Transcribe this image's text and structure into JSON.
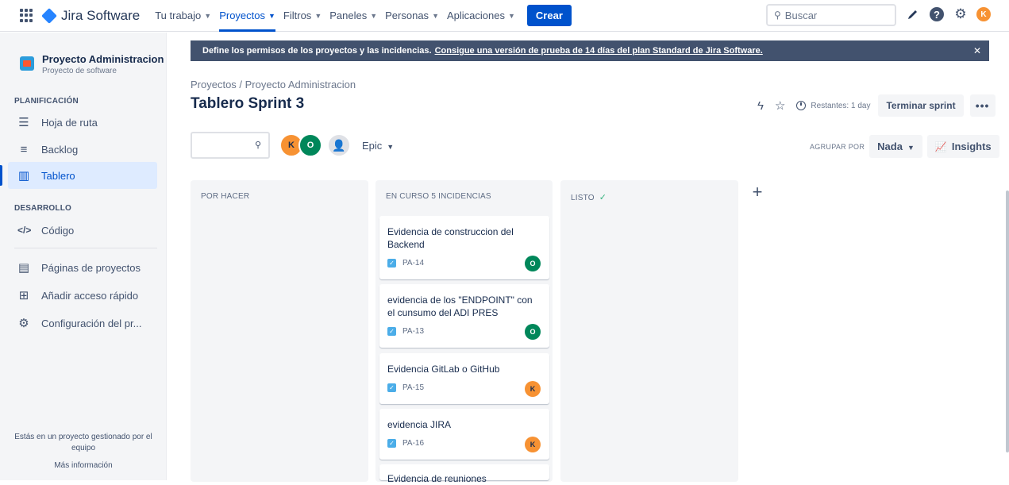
{
  "topnav": {
    "logo_text": "Jira Software",
    "items": [
      {
        "label": "Tu trabajo",
        "active": false
      },
      {
        "label": "Proyectos",
        "active": true
      },
      {
        "label": "Filtros",
        "active": false
      },
      {
        "label": "Paneles",
        "active": false
      },
      {
        "label": "Personas",
        "active": false
      },
      {
        "label": "Aplicaciones",
        "active": false
      }
    ],
    "create_label": "Crear",
    "search_placeholder": "Buscar",
    "user_initial": "K"
  },
  "sidebar": {
    "project_name": "Proyecto Administracion",
    "project_type": "Proyecto de software",
    "section_planning": "PLANIFICACIÓN",
    "section_dev": "DESARROLLO",
    "items": [
      {
        "label": "Hoja de ruta",
        "icon": "roadmap-icon"
      },
      {
        "label": "Backlog",
        "icon": "backlog-icon"
      },
      {
        "label": "Tablero",
        "icon": "board-icon"
      },
      {
        "label": "Código",
        "icon": "code-icon"
      },
      {
        "label": "Páginas de proyectos",
        "icon": "pages-icon"
      },
      {
        "label": "Añadir acceso rápido",
        "icon": "add-shortcut-icon"
      },
      {
        "label": "Configuración del pr...",
        "icon": "gear-icon"
      }
    ],
    "footer_text": "Estás en un proyecto gestionado por el equipo",
    "footer_link": "Más información"
  },
  "banner": {
    "text": "Define los permisos de los proyectos y las incidencias.",
    "link": "Consigue una versión de prueba de 14 días del plan Standard de Jira Software."
  },
  "breadcrumb": "Proyectos  /  Proyecto Administracion",
  "page_title": "Tablero Sprint 3",
  "header": {
    "remaining": "Restantes: 1 day",
    "complete_sprint": "Terminar sprint",
    "more": "•••"
  },
  "filters": {
    "avatar_k": "K",
    "avatar_o": "O",
    "epic_label": "Epic",
    "group_by_label": "AGRUPAR POR",
    "group_by_value": "Nada",
    "insights_label": "Insights"
  },
  "columns": [
    {
      "title": "POR HACER"
    },
    {
      "title": "EN CURSO 5 INCIDENCIAS"
    },
    {
      "title": "LISTO"
    }
  ],
  "cards": [
    {
      "title": "Evidencia de construccion del Backend",
      "key": "PA-14",
      "assignee": "O"
    },
    {
      "title": "evidencia de los \"ENDPOINT\" con el cunsumo del ADI PRES",
      "key": "PA-13",
      "assignee": "O"
    },
    {
      "title": "Evidencia GitLab o GitHub",
      "key": "PA-15",
      "assignee": "K"
    },
    {
      "title": "evidencia JIRA",
      "key": "PA-16",
      "assignee": "K"
    },
    {
      "title": "Evidencia de reuniones",
      "key": "",
      "assignee": ""
    }
  ]
}
